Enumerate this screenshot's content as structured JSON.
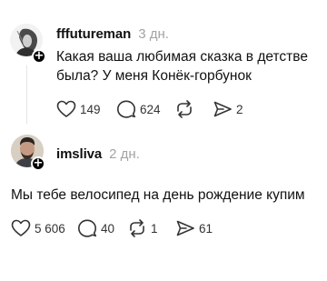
{
  "posts": [
    {
      "username": "fffutureman",
      "time": "3 дн.",
      "text": "Какая ваша любимая сказка в детстве была? У меня Конёк-горбунок",
      "likes": "149",
      "comments": "624",
      "reposts": "",
      "shares": "2",
      "icons": [
        "heart-icon",
        "comment-icon",
        "repost-icon",
        "share-icon"
      ]
    },
    {
      "username": "imsliva",
      "time": "2 дн.",
      "text": "Мы тебе велосипед на день рождение купим",
      "likes": "5 606",
      "comments": "40",
      "reposts": "1",
      "shares": "61",
      "icons": [
        "heart-icon",
        "comment-icon",
        "repost-icon",
        "share-icon"
      ]
    }
  ],
  "colors": {
    "text": "#111111",
    "muted": "#a3a3a3",
    "icon": "#333333",
    "badge": "#000000"
  }
}
